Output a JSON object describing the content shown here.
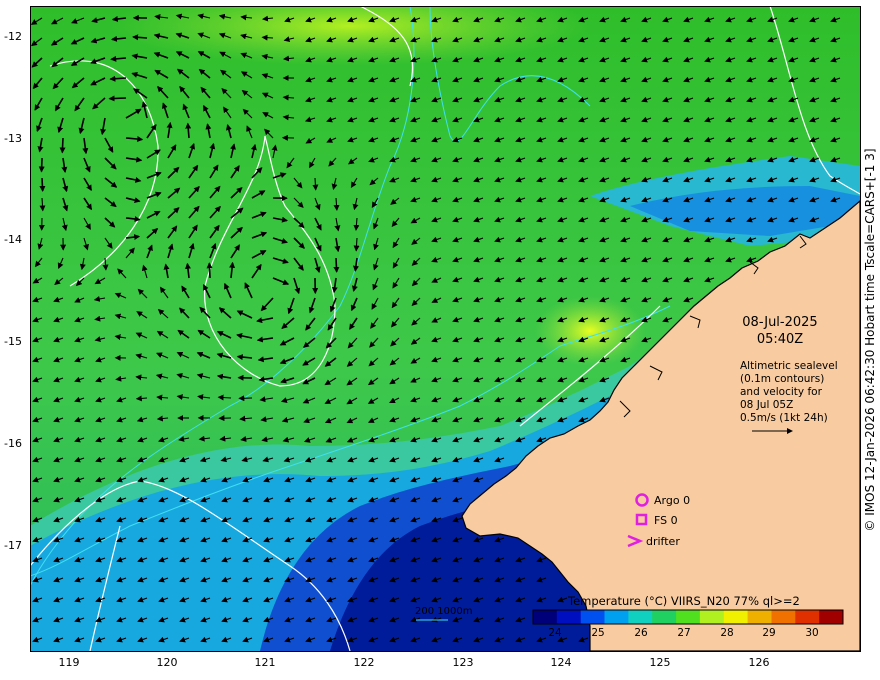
{
  "map": {
    "date": "08-Jul-2025",
    "time": "05:40Z",
    "altimetry_lines": [
      "Altimetric sealevel",
      "(0.1m contours)",
      "and velocity for",
      "08 Jul 05Z",
      "0.5m/s (1kt 24h)"
    ],
    "legend": [
      {
        "label": "Argo 0",
        "symbol": "circle-icon"
      },
      {
        "label": "FS 0",
        "symbol": "square-icon"
      },
      {
        "label": "drifter",
        "symbol": "chevron-icon"
      }
    ],
    "legend_color": "#e020e0",
    "colorbar_title": "Temperature (°C) VIIRS_N20 77% ql>=2",
    "colorbar_labels": [
      "24",
      "25",
      "26",
      "27",
      "28",
      "29",
      "30"
    ],
    "bathy_scale_label": "200  1000m",
    "copyright": "© IMOS 12-Jan-2026 06:42:30 Hobart time Tscale=CARS+[-1 3]",
    "y_ticks": [
      "-12",
      "-13",
      "-14",
      "-15",
      "-16",
      "-17"
    ],
    "x_ticks": [
      "119",
      "120",
      "121",
      "122",
      "123",
      "124",
      "125",
      "126"
    ],
    "colors": {
      "land": "#f8cba0",
      "coast": "#000000",
      "contour": "#ffffff",
      "isobath": "#40e0f0",
      "arrow": "#000000"
    }
  }
}
